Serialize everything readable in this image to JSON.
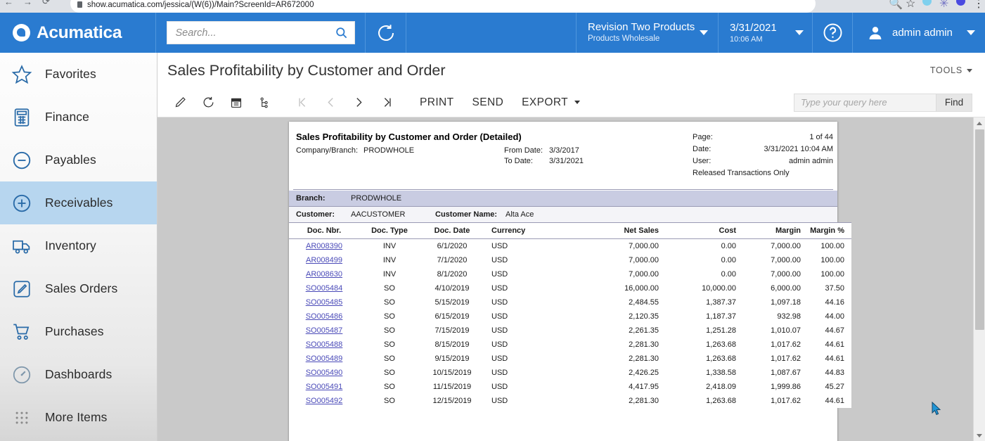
{
  "browser": {
    "url": "show.acumatica.com/jessica/(W(6))/Main?ScreenId=AR672000",
    "back_icon": "back-arrow-icon",
    "forward_icon": "forward-arrow-icon",
    "reload_icon": "reload-icon",
    "lock_icon": "lock-icon",
    "zoom_icon": "search-icon",
    "bookmark_icon": "star-icon",
    "menu_icon": "kebab-menu-icon",
    "ext1_color": "#7fd0ee",
    "ext2_color": "#4a4ab8",
    "profile_color": "#4a4ae0"
  },
  "header": {
    "brand": "Acumatica",
    "search": {
      "value": "",
      "placeholder": "Search..."
    },
    "recent_icon": "recent-history-icon",
    "company": {
      "name": "Revision Two Products",
      "branch": "Products Wholesale"
    },
    "date": {
      "date": "3/31/2021",
      "time": "10:06 AM"
    },
    "help_icon": "help-circle-icon",
    "user": {
      "name": "admin admin",
      "avatar_icon": "user-avatar-icon"
    },
    "accent_color": "#2a7bd0"
  },
  "sidebar": {
    "items": [
      {
        "label": "Favorites",
        "icon": "star-icon",
        "selected": false
      },
      {
        "label": "Finance",
        "icon": "calculator-icon",
        "selected": false
      },
      {
        "label": "Payables",
        "icon": "minus-circle-icon",
        "selected": false
      },
      {
        "label": "Receivables",
        "icon": "plus-circle-icon",
        "selected": true
      },
      {
        "label": "Inventory",
        "icon": "truck-icon",
        "selected": false
      },
      {
        "label": "Sales Orders",
        "icon": "pencil-square-icon",
        "selected": false
      },
      {
        "label": "Purchases",
        "icon": "shopping-cart-icon",
        "selected": false
      },
      {
        "label": "Dashboards",
        "icon": "gauge-icon",
        "selected": false
      },
      {
        "label": "More Items",
        "icon": "grid-dots-icon",
        "selected": false
      }
    ],
    "selected_color": "#b7d6ef"
  },
  "page": {
    "title": "Sales Profitability by Customer and Order",
    "tools_label": "TOOLS"
  },
  "toolbar": {
    "icons": [
      {
        "name": "edit-pencil-icon",
        "disabled": false
      },
      {
        "name": "refresh-icon",
        "disabled": false
      },
      {
        "name": "calendar-icon",
        "disabled": false
      },
      {
        "name": "schedule-icon",
        "disabled": false
      }
    ],
    "nav": [
      {
        "name": "first-page-icon",
        "disabled": true
      },
      {
        "name": "previous-page-icon",
        "disabled": true
      },
      {
        "name": "next-page-icon",
        "disabled": false
      },
      {
        "name": "last-page-icon",
        "disabled": false
      }
    ],
    "print_label": "PRINT",
    "send_label": "SEND",
    "export_label": "EXPORT",
    "find": {
      "value": "",
      "placeholder": "Type your query here",
      "button_label": "Find"
    }
  },
  "report": {
    "title": "Sales Profitability by Customer and Order (Detailed)",
    "company_branch_label": "Company/Branch:",
    "company_branch_value": "PRODWHOLE",
    "from_date_label": "From Date:",
    "from_date_value": "3/3/2017",
    "to_date_label": "To Date:",
    "to_date_value": "3/31/2021",
    "meta": {
      "page_label": "Page:",
      "page_value": "1 of 44",
      "date_label": "Date:",
      "date_value": "3/31/2021 10:04 AM",
      "user_label": "User:",
      "user_value": "admin admin",
      "note": "Released Transactions Only"
    },
    "branch_label": "Branch:",
    "branch_value": "PRODWHOLE",
    "customer_label": "Customer:",
    "customer_value": "AACUSTOMER",
    "customer_name_label": "Customer Name:",
    "customer_name_value": "Alta Ace",
    "columns": [
      "Doc. Nbr.",
      "Doc. Type",
      "Doc. Date",
      "Currency",
      "Net Sales",
      "Cost",
      "Margin",
      "Margin %"
    ],
    "rows": [
      {
        "doc": "AR008390",
        "type": "INV",
        "date": "6/1/2020",
        "currency": "USD",
        "net": "7,000.00",
        "cost": "0.00",
        "margin": "7,000.00",
        "pct": "100.00"
      },
      {
        "doc": "AR008499",
        "type": "INV",
        "date": "7/1/2020",
        "currency": "USD",
        "net": "7,000.00",
        "cost": "0.00",
        "margin": "7,000.00",
        "pct": "100.00"
      },
      {
        "doc": "AR008630",
        "type": "INV",
        "date": "8/1/2020",
        "currency": "USD",
        "net": "7,000.00",
        "cost": "0.00",
        "margin": "7,000.00",
        "pct": "100.00"
      },
      {
        "doc": "SO005484",
        "type": "SO",
        "date": "4/10/2019",
        "currency": "USD",
        "net": "16,000.00",
        "cost": "10,000.00",
        "margin": "6,000.00",
        "pct": "37.50"
      },
      {
        "doc": "SO005485",
        "type": "SO",
        "date": "5/15/2019",
        "currency": "USD",
        "net": "2,484.55",
        "cost": "1,387.37",
        "margin": "1,097.18",
        "pct": "44.16"
      },
      {
        "doc": "SO005486",
        "type": "SO",
        "date": "6/15/2019",
        "currency": "USD",
        "net": "2,120.35",
        "cost": "1,187.37",
        "margin": "932.98",
        "pct": "44.00"
      },
      {
        "doc": "SO005487",
        "type": "SO",
        "date": "7/15/2019",
        "currency": "USD",
        "net": "2,261.35",
        "cost": "1,251.28",
        "margin": "1,010.07",
        "pct": "44.67"
      },
      {
        "doc": "SO005488",
        "type": "SO",
        "date": "8/15/2019",
        "currency": "USD",
        "net": "2,281.30",
        "cost": "1,263.68",
        "margin": "1,017.62",
        "pct": "44.61"
      },
      {
        "doc": "SO005489",
        "type": "SO",
        "date": "9/15/2019",
        "currency": "USD",
        "net": "2,281.30",
        "cost": "1,263.68",
        "margin": "1,017.62",
        "pct": "44.61"
      },
      {
        "doc": "SO005490",
        "type": "SO",
        "date": "10/15/2019",
        "currency": "USD",
        "net": "2,426.25",
        "cost": "1,338.58",
        "margin": "1,087.67",
        "pct": "44.83"
      },
      {
        "doc": "SO005491",
        "type": "SO",
        "date": "11/15/2019",
        "currency": "USD",
        "net": "4,417.95",
        "cost": "2,418.09",
        "margin": "1,999.86",
        "pct": "45.27"
      },
      {
        "doc": "SO005492",
        "type": "SO",
        "date": "12/15/2019",
        "currency": "USD",
        "net": "2,281.30",
        "cost": "1,263.68",
        "margin": "1,017.62",
        "pct": "44.61"
      }
    ]
  }
}
